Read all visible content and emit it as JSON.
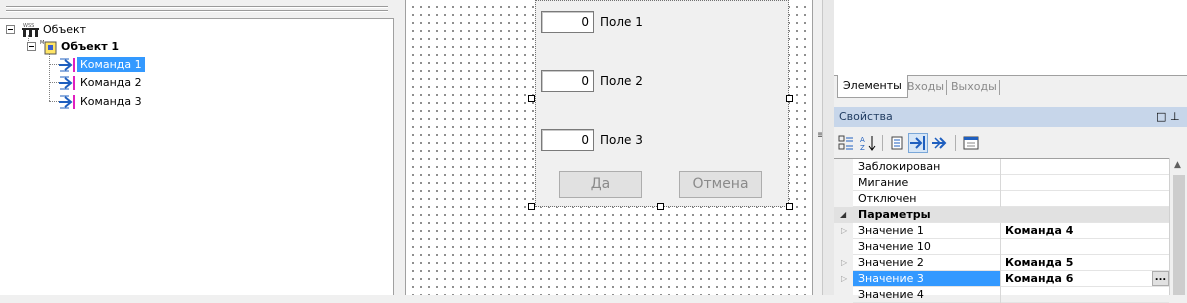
{
  "tree": {
    "root": {
      "label": "Объект"
    },
    "object": {
      "label": "Объект 1"
    },
    "commands": [
      {
        "label": "Команда 1",
        "selected": true
      },
      {
        "label": "Команда 2",
        "selected": false
      },
      {
        "label": "Команда 3",
        "selected": false
      }
    ]
  },
  "form": {
    "fields": [
      {
        "value": "0",
        "label": "Поле 1"
      },
      {
        "value": "0",
        "label": "Поле 2"
      },
      {
        "value": "0",
        "label": "Поле 3"
      }
    ],
    "ok_label": "Да",
    "cancel_label": "Отмена"
  },
  "tabs": {
    "elements": "Элементы",
    "inputs": "Входы",
    "outputs": "Выходы"
  },
  "properties": {
    "title": "Свойства",
    "rows": [
      {
        "name": "Заблокирован",
        "value": ""
      },
      {
        "name": "Мигание",
        "value": ""
      },
      {
        "name": "Отключен",
        "value": ""
      },
      {
        "name": "Параметры",
        "value": ""
      },
      {
        "name": "Значение 1",
        "value": "Команда 4"
      },
      {
        "name": "Значение 10",
        "value": ""
      },
      {
        "name": "Значение 2",
        "value": "Команда 5"
      },
      {
        "name": "Значение 3",
        "value": "Команда 6"
      },
      {
        "name": "Значение 4",
        "value": ""
      }
    ],
    "ellipsis": "..."
  },
  "colors": {
    "selection": "#3399ff",
    "header": "#c7d6ea",
    "command_icon": "#1f5fbf"
  }
}
